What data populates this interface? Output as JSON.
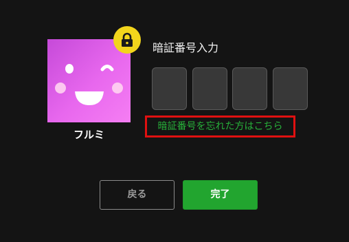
{
  "profile": {
    "name": "フルミ",
    "avatar_icon": "smiley-wink-face-icon",
    "avatar_color": "#e060ea",
    "badge_icon": "lock-icon",
    "badge_color": "#f2d51c"
  },
  "pin": {
    "title": "暗証番号入力",
    "digit_count": 4,
    "digits": [
      "",
      "",
      "",
      ""
    ],
    "forgot_link": "暗証番号を忘れた方はこちら",
    "forgot_link_color": "#27b03a",
    "highlight_color": "#e01010"
  },
  "buttons": {
    "back_label": "戻る",
    "done_label": "完了",
    "done_color": "#22a52f"
  }
}
